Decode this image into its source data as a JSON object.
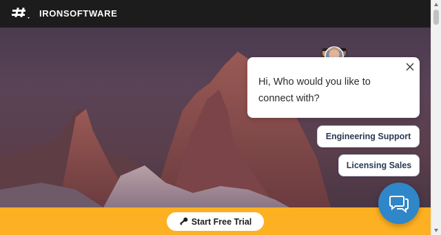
{
  "header": {
    "brand": "IRONSOFTWARE",
    "logo_icon": "hash-logo-icon"
  },
  "hero": {
    "image": "mountain-peaks-image"
  },
  "chat_widget": {
    "greeting": "Hi, Who would you like to connect with?",
    "options": [
      "Engineering Support",
      "Licensing Sales"
    ],
    "avatars_icon": "support-team-avatars",
    "close_icon": "close-icon",
    "launcher_icon": "chat-bubble-icon",
    "accent_color": "#2f86c8"
  },
  "bottom_bar": {
    "cta_label": "Start Free Trial",
    "cta_icon": "key-icon",
    "background_color": "#fdb022"
  }
}
